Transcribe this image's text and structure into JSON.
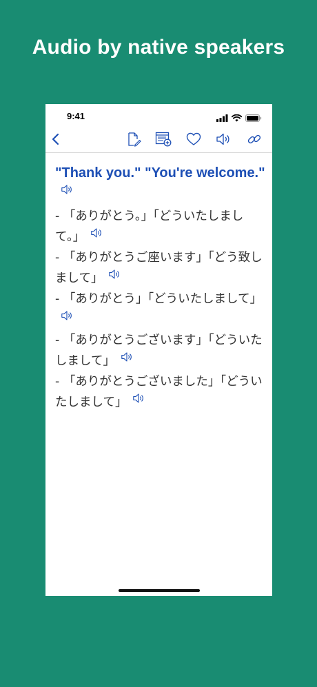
{
  "headline": "Audio by native speakers",
  "status_bar": {
    "time": "9:41"
  },
  "toolbar": {
    "icons": [
      "back-chevron-icon",
      "edit-note-icon",
      "add-to-list-icon",
      "heart-icon",
      "speaker-icon",
      "link-icon"
    ]
  },
  "entry": {
    "title": "\"Thank you.\" \"You're welcome.\"",
    "sentences": [
      "- 「ありがとう。」「どういたしまして。」",
      "- 「ありがとうご座います」「どう致しまして」",
      "- 「ありがとう」「どういたしまして」",
      "- 「ありがとうございます」「どういたしまして」",
      "- 「ありがとうございました」「どういたしまして」"
    ]
  },
  "colors": {
    "background": "#198c72",
    "accent_blue": "#1d4fb5",
    "text": "#333333"
  }
}
